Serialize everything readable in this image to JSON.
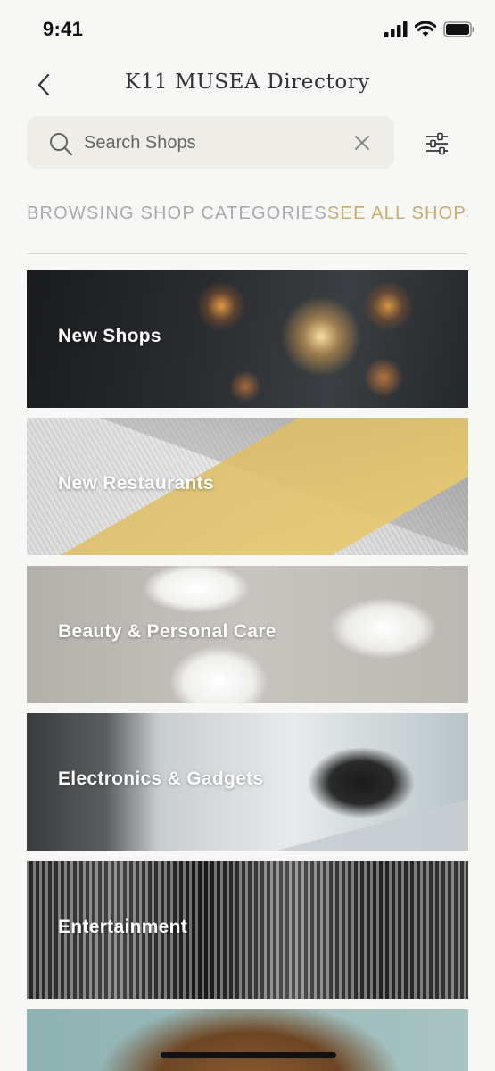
{
  "status_bar": {
    "time": "9:41",
    "icons": [
      "cellular-signal-icon",
      "wifi-icon",
      "battery-icon"
    ]
  },
  "nav": {
    "title": "K11 MUSEA Directory",
    "back_icon": "chevron-left-icon"
  },
  "search": {
    "placeholder": "Search Shops",
    "value": "",
    "search_icon": "search-icon",
    "clear_icon": "close-icon"
  },
  "filter_icon": "sliders-icon",
  "section": {
    "title": "BROWSING SHOP CATEGORIES",
    "link": "SEE ALL SHOPS"
  },
  "categories": [
    {
      "label": "New Shops"
    },
    {
      "label": "New Restaurants"
    },
    {
      "label": "Beauty & Personal Care"
    },
    {
      "label": "Electronics & Gadgets"
    },
    {
      "label": "Entertainment"
    },
    {
      "label": ""
    }
  ],
  "colors": {
    "background": "#f7f7f6",
    "search_bg": "#efede8",
    "accent_gold": "#c7ac6e",
    "muted_text": "#aaaaaa"
  }
}
